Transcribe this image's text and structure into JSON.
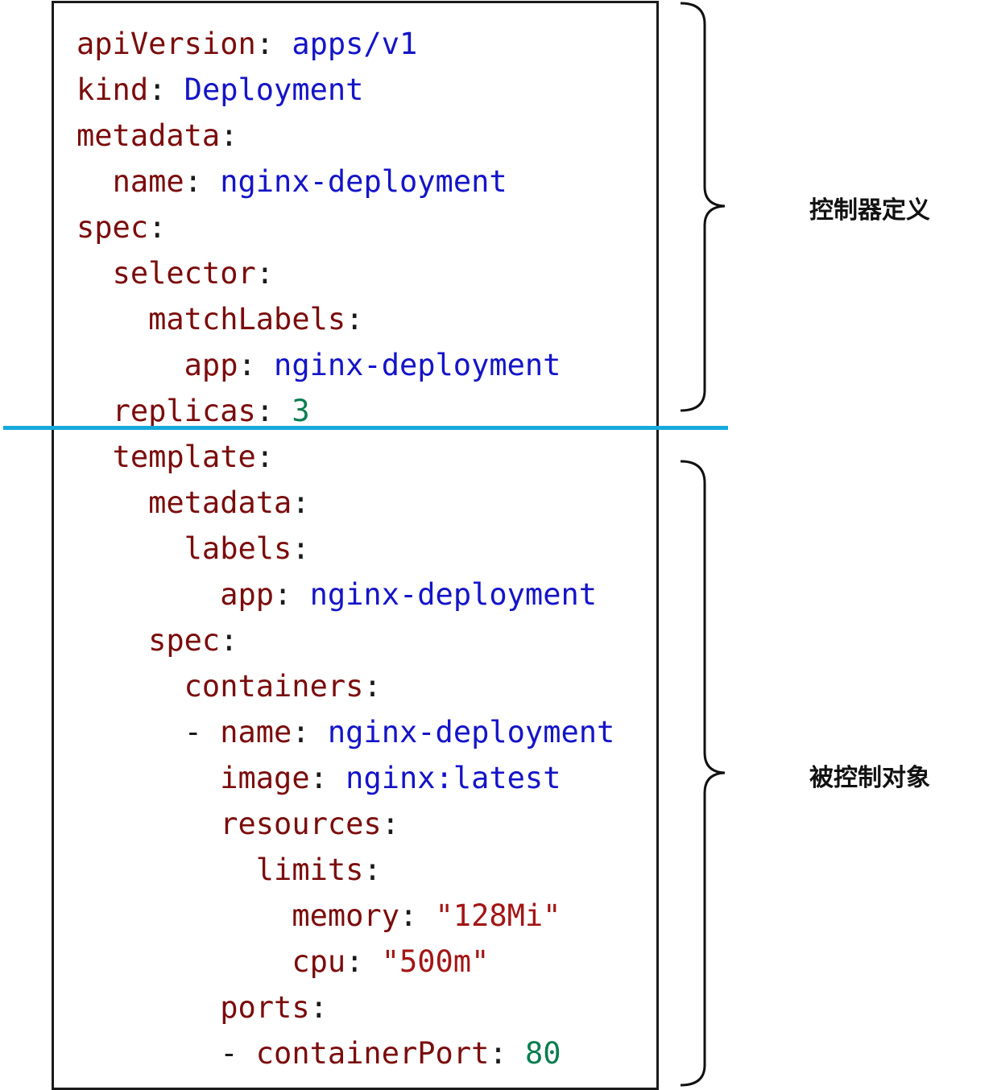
{
  "code_lines": [
    {
      "indent": "",
      "dash": "",
      "key": "apiVersion",
      "value": "apps/v1",
      "value_type": "string"
    },
    {
      "indent": "",
      "dash": "",
      "key": "kind",
      "value": "Deployment",
      "value_type": "string"
    },
    {
      "indent": "",
      "dash": "",
      "key": "metadata",
      "value": "",
      "value_type": ""
    },
    {
      "indent": "  ",
      "dash": "",
      "key": "name",
      "value": "nginx-deployment",
      "value_type": "string"
    },
    {
      "indent": "",
      "dash": "",
      "key": "spec",
      "value": "",
      "value_type": ""
    },
    {
      "indent": "  ",
      "dash": "",
      "key": "selector",
      "value": "",
      "value_type": ""
    },
    {
      "indent": "    ",
      "dash": "",
      "key": "matchLabels",
      "value": "",
      "value_type": ""
    },
    {
      "indent": "      ",
      "dash": "",
      "key": "app",
      "value": "nginx-deployment",
      "value_type": "string"
    },
    {
      "indent": "  ",
      "dash": "",
      "key": "replicas",
      "value": "3",
      "value_type": "number"
    },
    {
      "indent": "  ",
      "dash": "",
      "key": "template",
      "value": "",
      "value_type": ""
    },
    {
      "indent": "    ",
      "dash": "",
      "key": "metadata",
      "value": "",
      "value_type": ""
    },
    {
      "indent": "      ",
      "dash": "",
      "key": "labels",
      "value": "",
      "value_type": ""
    },
    {
      "indent": "        ",
      "dash": "",
      "key": "app",
      "value": "nginx-deployment",
      "value_type": "string"
    },
    {
      "indent": "    ",
      "dash": "",
      "key": "spec",
      "value": "",
      "value_type": ""
    },
    {
      "indent": "      ",
      "dash": "",
      "key": "containers",
      "value": "",
      "value_type": ""
    },
    {
      "indent": "      ",
      "dash": "- ",
      "key": "name",
      "value": "nginx-deployment",
      "value_type": "string"
    },
    {
      "indent": "        ",
      "dash": "",
      "key": "image",
      "value": "nginx:latest",
      "value_type": "string"
    },
    {
      "indent": "        ",
      "dash": "",
      "key": "resources",
      "value": "",
      "value_type": ""
    },
    {
      "indent": "          ",
      "dash": "",
      "key": "limits",
      "value": "",
      "value_type": ""
    },
    {
      "indent": "            ",
      "dash": "",
      "key": "memory",
      "value": "\"128Mi\"",
      "value_type": "quoted"
    },
    {
      "indent": "            ",
      "dash": "",
      "key": "cpu",
      "value": "\"500m\"",
      "value_type": "quoted"
    },
    {
      "indent": "        ",
      "dash": "",
      "key": "ports",
      "value": "",
      "value_type": ""
    },
    {
      "indent": "        ",
      "dash": "- ",
      "key": "containerPort",
      "value": "80",
      "value_type": "number"
    }
  ],
  "annotations": {
    "controller_label": "控制器定义",
    "controlled_label": "被控制对象"
  },
  "colors": {
    "key": "#7b0c0c",
    "string_value": "#1414c8",
    "number_value": "#0a7d4f",
    "quoted_value": "#a31515",
    "punctuation": "#1a1a1a",
    "divider": "#16a9db",
    "border": "#1a1a1a"
  }
}
